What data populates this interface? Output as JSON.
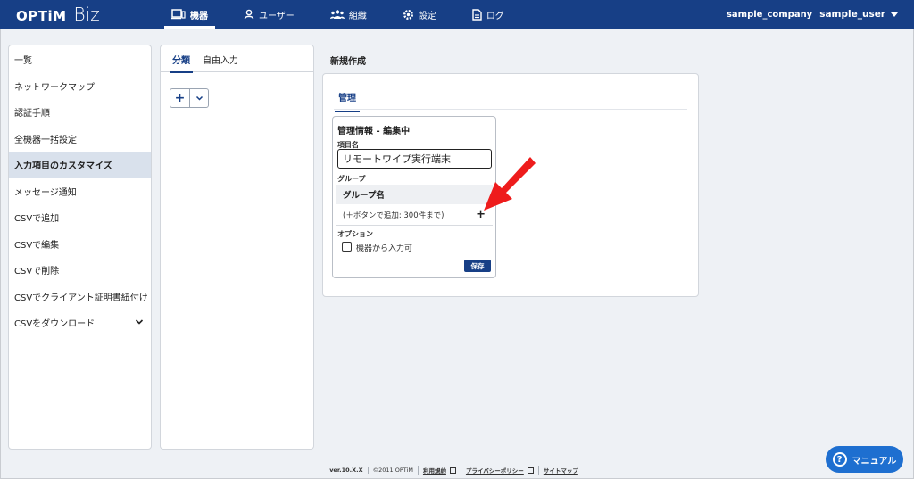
{
  "header": {
    "logo_main": "OPTiM",
    "logo_sub": "Biz",
    "nav": [
      {
        "label": "機器",
        "icon": "device-icon"
      },
      {
        "label": "ユーザー",
        "icon": "user-icon"
      },
      {
        "label": "組織",
        "icon": "organization-icon"
      },
      {
        "label": "設定",
        "icon": "gear-icon"
      },
      {
        "label": "ログ",
        "icon": "log-icon"
      }
    ],
    "company": "sample_company",
    "user": "sample_user"
  },
  "sidebar": {
    "items": [
      {
        "label": "一覧"
      },
      {
        "label": "ネットワークマップ"
      },
      {
        "label": "認証手順"
      },
      {
        "label": "全機器一括設定"
      },
      {
        "label": "入力項目のカスタマイズ"
      },
      {
        "label": "メッセージ通知"
      },
      {
        "label": "CSVで追加"
      },
      {
        "label": "CSVで編集"
      },
      {
        "label": "CSVで削除"
      },
      {
        "label": "CSVでクライアント証明書紐付け"
      },
      {
        "label": "CSVをダウンロード"
      }
    ]
  },
  "middle": {
    "tabs": [
      {
        "label": "分類"
      },
      {
        "label": "自由入力"
      }
    ],
    "add_button": "+"
  },
  "main": {
    "title": "新規作成",
    "tab": "管理",
    "panel_title": "管理情報 - 編集中",
    "item_name_label": "項目名",
    "item_name_value": "リモートワイプ実行端末",
    "group_label": "グループ",
    "group_header": "グループ名",
    "group_hint": "(＋ボタンで追加: 300件まで)",
    "group_add": "+",
    "option_label": "オプション",
    "option_checkbox": "機器から入力可",
    "save_label": "保存"
  },
  "footer": {
    "version": "ver.10.X.X",
    "copyright": "©2011 OPTiM",
    "terms": "利用規約",
    "privacy": "プライバシーポリシー",
    "sitemap": "サイトマップ"
  },
  "manual_button": "マニュアル",
  "colors": {
    "header_bg": "#173f86",
    "accent": "#173f86",
    "arrow": "#ee1c1c",
    "manual_btn": "#1e6fd0"
  }
}
